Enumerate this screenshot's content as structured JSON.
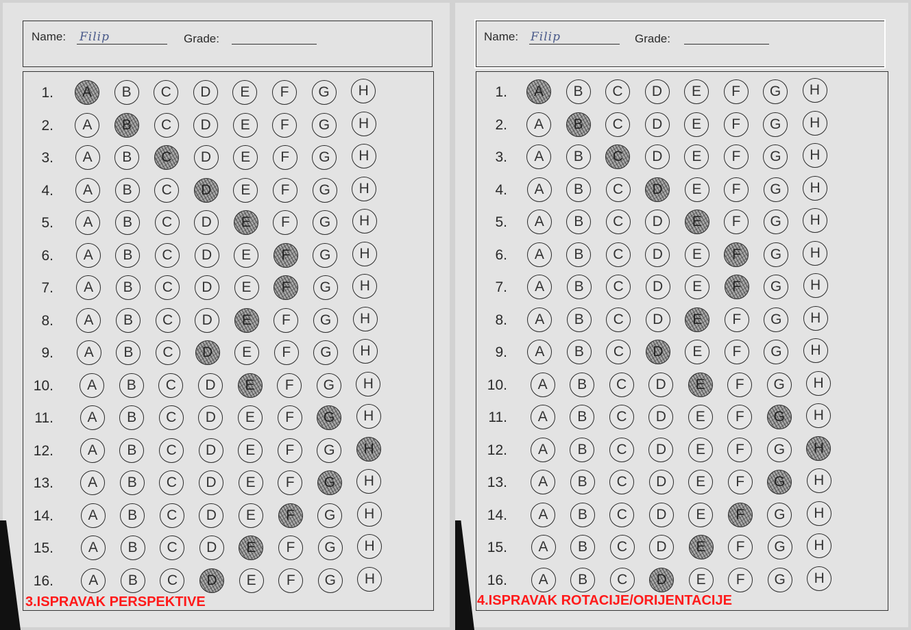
{
  "form": {
    "name_label": "Name:",
    "name_value": "Filip",
    "grade_label": "Grade:"
  },
  "options": [
    "A",
    "B",
    "C",
    "D",
    "E",
    "F",
    "G",
    "H"
  ],
  "questions": [
    {
      "num": "1.",
      "answer": "A"
    },
    {
      "num": "2.",
      "answer": "B"
    },
    {
      "num": "3.",
      "answer": "C"
    },
    {
      "num": "4.",
      "answer": "D"
    },
    {
      "num": "5.",
      "answer": "E"
    },
    {
      "num": "6.",
      "answer": "F"
    },
    {
      "num": "7.",
      "answer": "F"
    },
    {
      "num": "8.",
      "answer": "E"
    },
    {
      "num": "9.",
      "answer": "D"
    },
    {
      "num": "10.",
      "answer": "E"
    },
    {
      "num": "11.",
      "answer": "G"
    },
    {
      "num": "12.",
      "answer": "H"
    },
    {
      "num": "13.",
      "answer": "G"
    },
    {
      "num": "14.",
      "answer": "F"
    },
    {
      "num": "15.",
      "answer": "E"
    },
    {
      "num": "16.",
      "answer": "D"
    }
  ],
  "panels": [
    {
      "caption": "3.ISPRAVAK PERSPEKTIVE",
      "header_highlighted": false
    },
    {
      "caption": "4.ISPRAVAK ROTACIJE/ORIJENTACIJE",
      "header_highlighted": true
    }
  ],
  "colors": {
    "caption": "#ff1a1a",
    "paper": "#e3e3e3",
    "background": "#d2d2d2",
    "highlight": "#ffffff"
  }
}
